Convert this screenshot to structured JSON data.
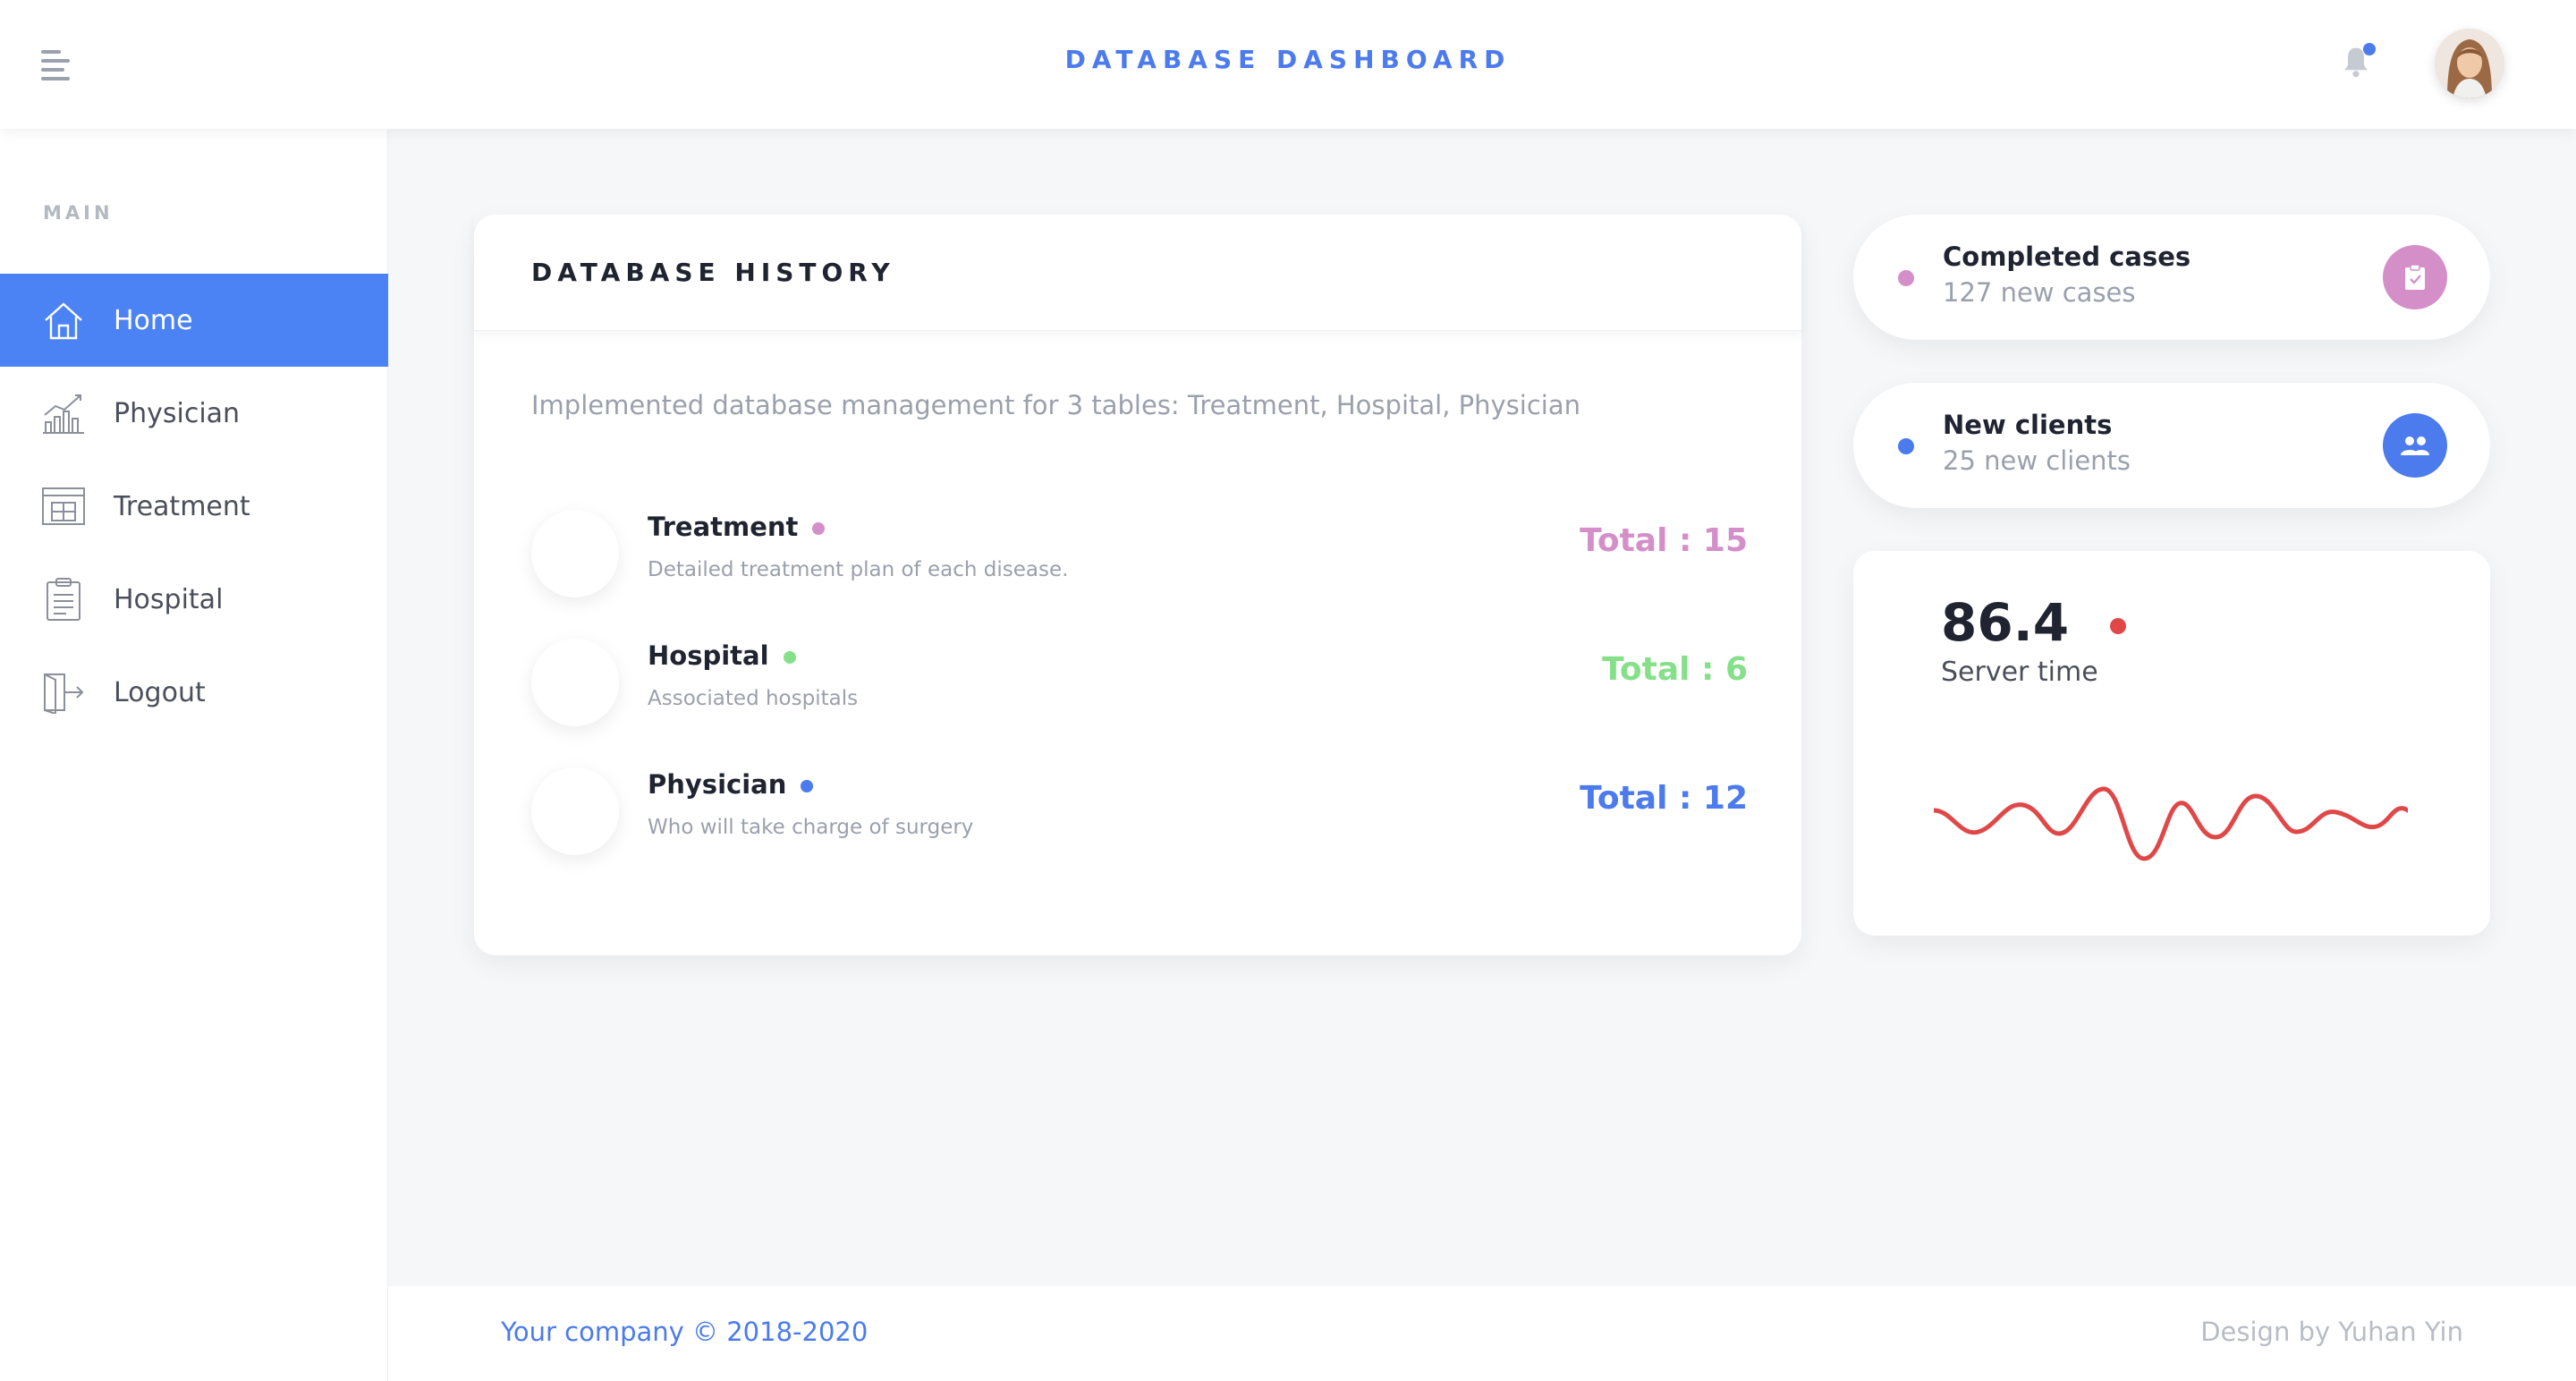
{
  "header": {
    "title": "DATABASE DASHBOARD"
  },
  "sidebar": {
    "section_label": "MAIN",
    "items": [
      {
        "label": "Home",
        "icon": "home-icon"
      },
      {
        "label": "Physician",
        "icon": "chart-icon"
      },
      {
        "label": "Treatment",
        "icon": "table-icon"
      },
      {
        "label": "Hospital",
        "icon": "clipboard-icon"
      },
      {
        "label": "Logout",
        "icon": "logout-icon"
      }
    ],
    "active_index": 0
  },
  "history": {
    "title": "DATABASE HISTORY",
    "description": "Implemented database management for 3 tables: Treatment, Hospital, Physician",
    "rows": [
      {
        "title": "Treatment",
        "subtitle": "Detailed treatment plan of each disease.",
        "total": "Total : 15",
        "color": "#d48fc9"
      },
      {
        "title": "Hospital",
        "subtitle": "Associated hospitals",
        "total": "Total : 6",
        "color": "#86e08a"
      },
      {
        "title": "Physician",
        "subtitle": "Who will take charge of surgery",
        "total": "Total : 12",
        "color": "#4b7bec"
      }
    ]
  },
  "stats": {
    "completed": {
      "title": "Completed cases",
      "subtitle": "127 new cases",
      "color": "#d48fc9",
      "icon": "clipboard-check-icon"
    },
    "clients": {
      "title": "New clients",
      "subtitle": "25 new clients",
      "color": "#4b7bec",
      "icon": "users-icon"
    }
  },
  "server": {
    "value": "86.4",
    "label": "Server time",
    "dot_color": "#e04848",
    "line_color": "#e04848"
  },
  "footer": {
    "copyright": "Your company © 2018-2020",
    "design": "Design by Yuhan Yin"
  },
  "colors": {
    "accent": "#4b7bec",
    "active_nav": "#4b83f4"
  }
}
